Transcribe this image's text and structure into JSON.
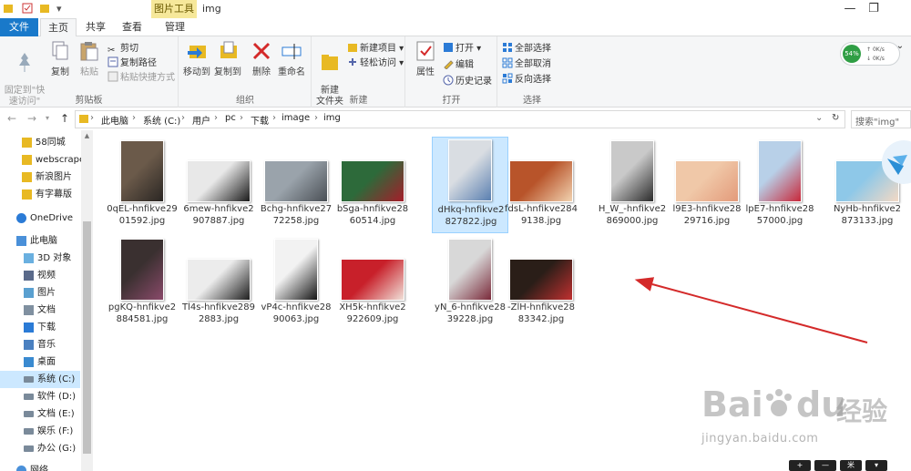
{
  "window": {
    "context_tab": "图片工具",
    "title": "img"
  },
  "ribbon_tabs": {
    "file": "文件",
    "home": "主页",
    "share": "共享",
    "view": "查看",
    "manage": "管理"
  },
  "ribbon": {
    "clipboard": {
      "label": "剪贴板",
      "pin": "固定到\"快\n速访问\"",
      "copy": "复制",
      "paste": "粘贴",
      "cut": "剪切",
      "copy_path": "复制路径",
      "paste_shortcut": "粘贴快捷方式"
    },
    "organize": {
      "label": "组织",
      "move_to": "移动到",
      "copy_to": "复制到",
      "delete": "删除",
      "rename": "重命名"
    },
    "new": {
      "label": "新建",
      "new_folder": "新建\n文件夹",
      "new_item": "新建项目",
      "easy_access": "轻松访问"
    },
    "open": {
      "label": "打开",
      "properties": "属性",
      "open": "打开",
      "edit": "编辑",
      "history": "历史记录"
    },
    "select": {
      "label": "选择",
      "select_all": "全部选择",
      "select_none": "全部取消",
      "invert": "反向选择"
    }
  },
  "net_widget": {
    "percent": "54%",
    "up": "0K/s",
    "down": "0K/s"
  },
  "address": {
    "crumbs": [
      "此电脑",
      "系统 (C:)",
      "用户",
      "pc",
      "下载",
      "image",
      "img"
    ],
    "search_placeholder": "搜索\"img\""
  },
  "nav": {
    "items": [
      {
        "label": "58同城",
        "icon": "folder-icon"
      },
      {
        "label": "webscrape",
        "icon": "folder-icon"
      },
      {
        "label": "新浪图片",
        "icon": "folder-icon"
      },
      {
        "label": "有字幕版",
        "icon": "folder-icon"
      },
      {
        "label": "OneDrive",
        "icon": "cloud-icon"
      },
      {
        "label": "此电脑",
        "icon": "computer-icon"
      },
      {
        "label": "3D 对象",
        "icon": "cube-icon"
      },
      {
        "label": "视频",
        "icon": "video-icon"
      },
      {
        "label": "图片",
        "icon": "picture-icon"
      },
      {
        "label": "文档",
        "icon": "document-icon"
      },
      {
        "label": "下载",
        "icon": "download-icon"
      },
      {
        "label": "音乐",
        "icon": "music-icon"
      },
      {
        "label": "桌面",
        "icon": "desktop-icon"
      },
      {
        "label": "系统 (C:)",
        "icon": "drive-icon"
      },
      {
        "label": "软件 (D:)",
        "icon": "drive-icon"
      },
      {
        "label": "文档 (E:)",
        "icon": "drive-icon"
      },
      {
        "label": "娱乐 (F:)",
        "icon": "drive-icon"
      },
      {
        "label": "办公 (G:)",
        "icon": "drive-icon"
      },
      {
        "label": "网络",
        "icon": "network-icon"
      }
    ]
  },
  "files": [
    {
      "line1": "0qEL-hnfikve29",
      "line2": "01592.jpg",
      "orient": "portrait",
      "c1": "#6b5a4a",
      "c2": "#2a2623"
    },
    {
      "line1": "6mew-hnfikve2",
      "line2": "907887.jpg",
      "orient": "landscape",
      "c1": "#e8e8e8",
      "c2": "#1a1a1a"
    },
    {
      "line1": "Bchg-hnfikve27",
      "line2": "72258.jpg",
      "orient": "landscape",
      "c1": "#9aa3ab",
      "c2": "#4a4f55"
    },
    {
      "line1": "bSga-hnfikve28",
      "line2": "60514.jpg",
      "orient": "landscape",
      "c1": "#2d6a3a",
      "c2": "#a51d2a"
    },
    {
      "line1": "dHkq-hnfikve2",
      "line2": "827822.jpg",
      "orient": "portrait",
      "c1": "#d9dde2",
      "c2": "#5a7fb0"
    },
    {
      "line1": "fdsL-hnfikve284",
      "line2": "9138.jpg",
      "orient": "landscape",
      "c1": "#b8542a",
      "c2": "#f1d2b0"
    },
    {
      "line1": "H_W_-hnfikve2",
      "line2": "869000.jpg",
      "orient": "portrait",
      "c1": "#c9c9c9",
      "c2": "#2b2b2b"
    },
    {
      "line1": "l9E3-hnfikve28",
      "line2": "29716.jpg",
      "orient": "landscape",
      "c1": "#f0c8a8",
      "c2": "#e39a7a"
    },
    {
      "line1": "lpE7-hnfikve28",
      "line2": "57000.jpg",
      "orient": "portrait",
      "c1": "#b8d0e8",
      "c2": "#c8283a"
    },
    {
      "line1": "NyHb-hnfikve2",
      "line2": "873133.jpg",
      "orient": "landscape",
      "c1": "#8ec8e8",
      "c2": "#f4d9c4"
    },
    {
      "line1": "pgKQ-hnfikve2",
      "line2": "884581.jpg",
      "orient": "portrait",
      "c1": "#3a3030",
      "c2": "#8a4a6a"
    },
    {
      "line1": "Tl4s-hnfikve289",
      "line2": "2883.jpg",
      "orient": "landscape",
      "c1": "#ececec",
      "c2": "#1e1e1e"
    },
    {
      "line1": "vP4c-hnfikve28",
      "line2": "90063.jpg",
      "orient": "portrait",
      "c1": "#f2f2f2",
      "c2": "#151515"
    },
    {
      "line1": "XH5k-hnfikve2",
      "line2": "922609.jpg",
      "orient": "landscape",
      "c1": "#c8202a",
      "c2": "#f0e0d8"
    },
    {
      "line1": "yN_6-hnfikve28",
      "line2": "39228.jpg",
      "orient": "portrait",
      "c1": "#d8d8d8",
      "c2": "#7a2a3a"
    },
    {
      "line1": "-ZlH-hnfikve28",
      "line2": "83342.jpg",
      "orient": "landscape",
      "c1": "#2a1e18",
      "c2": "#c03030"
    }
  ],
  "watermark": {
    "brand": "Bai",
    "brand2": "du",
    "cn": "经验",
    "url": "jingyan.baidu.com"
  },
  "bottom_tools": [
    "+",
    "—",
    "米",
    "▾"
  ],
  "colors": {
    "accent": "#1979ca",
    "selection": "#cce8ff",
    "context_tab": "#f6e89a",
    "arrow": "#d42a2a"
  }
}
